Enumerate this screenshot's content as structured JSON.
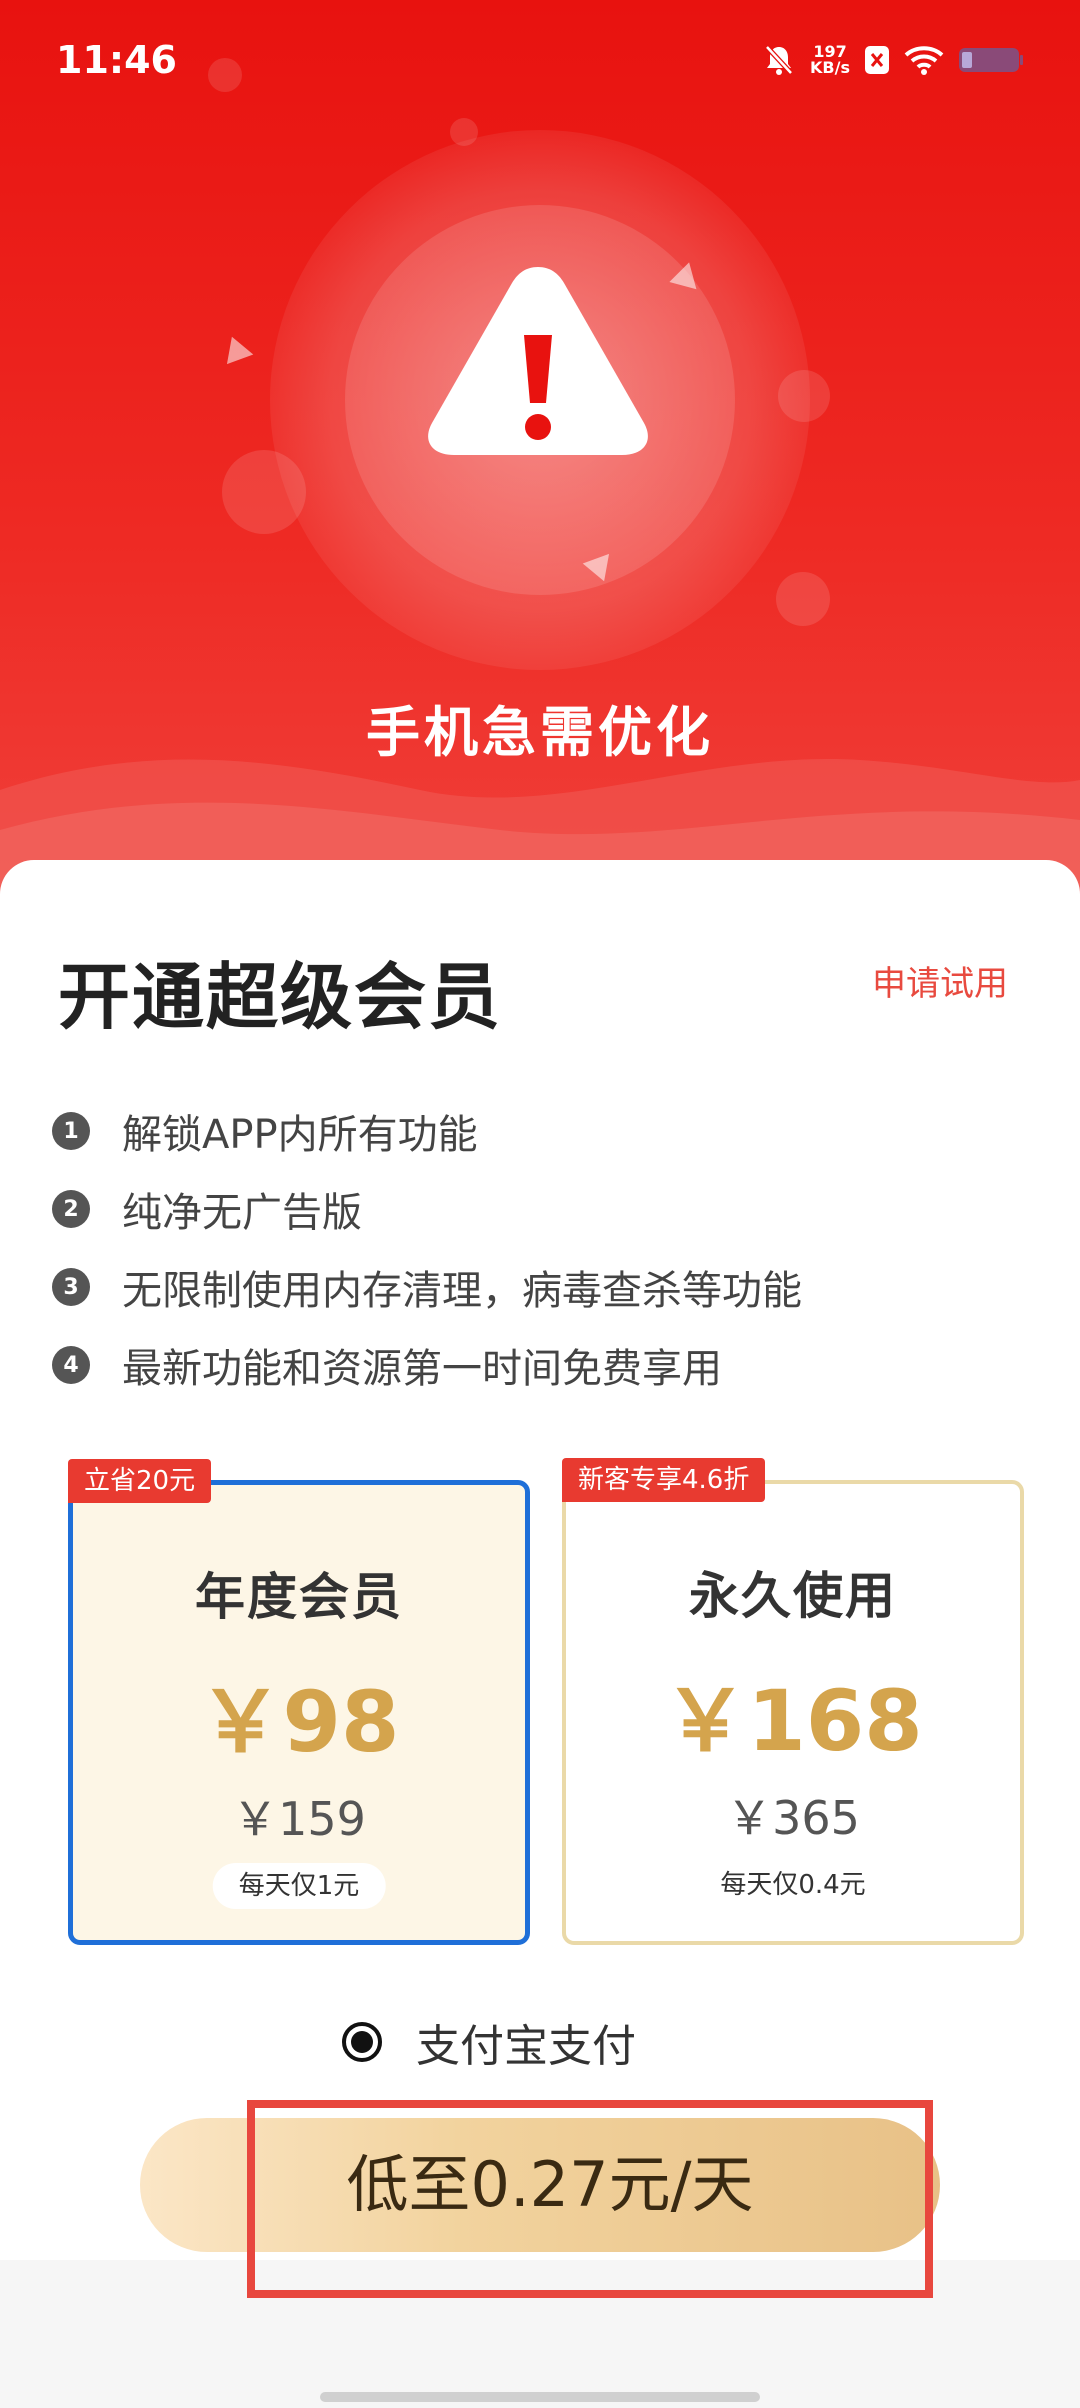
{
  "status_bar": {
    "time": "11:46",
    "net_speed_value": "197",
    "net_speed_unit": "KB/s"
  },
  "hero": {
    "title": "手机急需优化"
  },
  "membership": {
    "title": "开通超级会员",
    "trial_label": "申请试用",
    "features": [
      {
        "num": "1",
        "text": "解锁APP内所有功能"
      },
      {
        "num": "2",
        "text": "纯净无广告版"
      },
      {
        "num": "3",
        "text": "无限制使用内存清理，病毒查杀等功能"
      },
      {
        "num": "4",
        "text": "最新功能和资源第一时间免费享用"
      }
    ]
  },
  "plans": [
    {
      "tag": "立省20元",
      "name": "年度会员",
      "price": "￥98",
      "original_price": "￥159",
      "daily": "每天仅1元",
      "selected": true
    },
    {
      "tag": "新客专享4.6折",
      "name": "永久使用",
      "price": "￥168",
      "original_price": "￥365",
      "daily": "每天仅0.4元",
      "selected": false
    }
  ],
  "payment": {
    "method_label": "支付宝支付",
    "selected": true
  },
  "cta": {
    "label": "低至0.27元/天"
  },
  "colors": {
    "hero_red": "#e8120f",
    "accent_red": "#e84a3f",
    "gold": "#d4a44d",
    "selected_border": "#1f6fd8"
  }
}
